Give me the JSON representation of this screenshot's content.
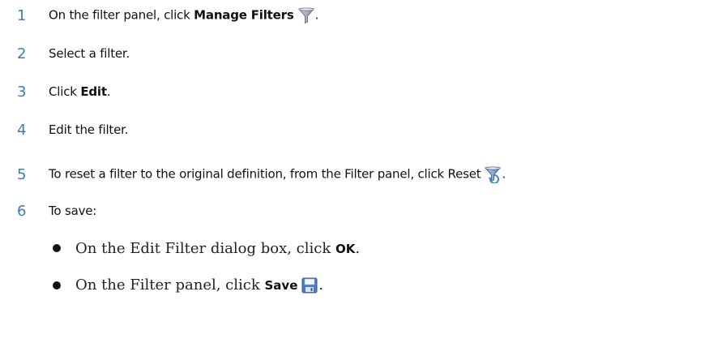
{
  "steps": [
    {
      "number": "1",
      "prefix": "On the filter panel, click ",
      "bold": "Manage Filters",
      "suffix": ".",
      "icon": "funnel-icon"
    },
    {
      "number": "2",
      "text": "Select a filter."
    },
    {
      "number": "3",
      "prefix": "Click ",
      "bold": "Edit",
      "suffix": "."
    },
    {
      "number": "4",
      "text": "Edit the filter."
    },
    {
      "number": "5",
      "prefix": "To reset a filter to the original definition, from the Filter panel, click Reset",
      "suffix": ".",
      "icon": "reset-filter-icon"
    },
    {
      "number": "6",
      "text": "To save:"
    }
  ],
  "bullets": [
    {
      "prefix": "On the Edit Filter dialog box, click ",
      "bold": "OK",
      "suffix": "."
    },
    {
      "prefix": "On the Filter panel, click ",
      "bold": "Save",
      "suffix": ".",
      "icon": "save-icon"
    }
  ],
  "colors": {
    "step_number": "#3c7fa8",
    "text": "#111111"
  }
}
